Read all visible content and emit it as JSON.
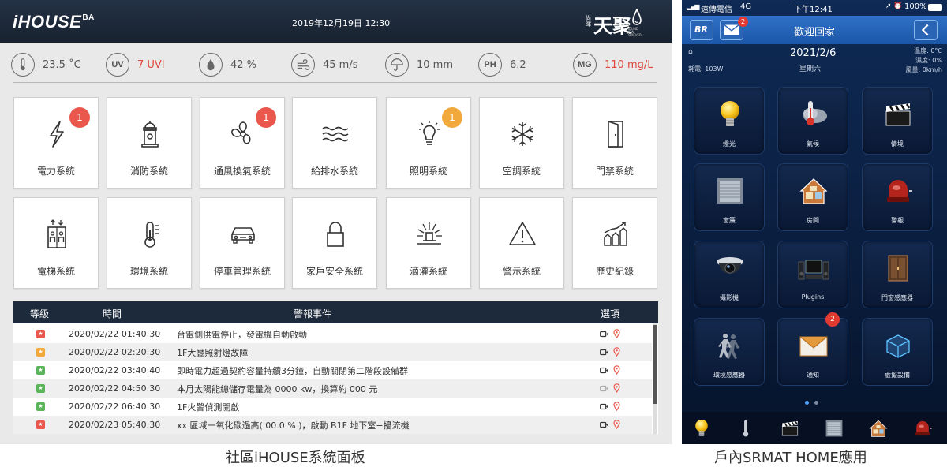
{
  "dashboard": {
    "brand": "iHOUSE",
    "brand_sup": "BA",
    "datetime": "2019年12月19日 12:30",
    "logo": {
      "small": "尚暉",
      "big": "天聚",
      "tiny": "ROUND NEW FOREVER"
    },
    "env": [
      {
        "icon": "thermometer-icon",
        "label": "",
        "value": "23.5 ˚C",
        "alert": false
      },
      {
        "icon": "uv-icon",
        "label": "UV",
        "value": "7 UVI",
        "alert": true
      },
      {
        "icon": "humidity-drop-icon",
        "label": "",
        "value": "42 %",
        "alert": false
      },
      {
        "icon": "wind-icon",
        "label": "",
        "value": "45 m/s",
        "alert": false
      },
      {
        "icon": "umbrella-icon",
        "label": "",
        "value": "10 mm",
        "alert": false
      },
      {
        "icon": "ph-icon",
        "label": "PH",
        "value": "6.2",
        "alert": false
      },
      {
        "icon": "mg-icon",
        "label": "MG",
        "value": "110 mg/L",
        "alert": true
      }
    ],
    "systems": [
      {
        "label": "電力系統",
        "icon": "lightning-icon",
        "badge": "1",
        "badge_color": "#e9574d"
      },
      {
        "label": "消防系統",
        "icon": "fire-hydrant-icon",
        "badge": "",
        "badge_color": ""
      },
      {
        "label": "通風換氣系統",
        "icon": "fan-icon",
        "badge": "1",
        "badge_color": "#e9574d"
      },
      {
        "label": "給排水系統",
        "icon": "water-waves-icon",
        "badge": "",
        "badge_color": ""
      },
      {
        "label": "照明系統",
        "icon": "light-bulb-icon",
        "badge": "1",
        "badge_color": "#f2a93b"
      },
      {
        "label": "空調系統",
        "icon": "snowflake-icon",
        "badge": "",
        "badge_color": ""
      },
      {
        "label": "門禁系統",
        "icon": "door-icon",
        "badge": "",
        "badge_color": ""
      },
      {
        "label": "電梯系統",
        "icon": "elevator-icon",
        "badge": "",
        "badge_color": ""
      },
      {
        "label": "環境系統",
        "icon": "thermometer-icon",
        "badge": "",
        "badge_color": ""
      },
      {
        "label": "停車管理系統",
        "icon": "car-icon",
        "badge": "",
        "badge_color": ""
      },
      {
        "label": "家戶安全系統",
        "icon": "lock-icon",
        "badge": "",
        "badge_color": ""
      },
      {
        "label": "滴灌系統",
        "icon": "sprinkler-icon",
        "badge": "",
        "badge_color": ""
      },
      {
        "label": "警示系統",
        "icon": "warning-icon",
        "badge": "",
        "badge_color": ""
      },
      {
        "label": "歷史紀錄",
        "icon": "chart-history-icon",
        "badge": "",
        "badge_color": ""
      }
    ],
    "alarm_table": {
      "headers": {
        "level": "等級",
        "time": "時間",
        "event": "警報事件",
        "options": "選項"
      },
      "rows": [
        {
          "level_color": "#e9574d",
          "time": "2020/02/22 01:40:30",
          "event": "台電側供電停止，發電機自動啟動",
          "cam_active": true
        },
        {
          "level_color": "#f2a93b",
          "time": "2020/02/22 02:20:30",
          "event": "1F大廳照射燈故障",
          "cam_active": true
        },
        {
          "level_color": "#5bb45a",
          "time": "2020/02/22 03:40:40",
          "event": "即時電力超過契約容量持續3分鐘，自動關閉第二階段設備群",
          "cam_active": true
        },
        {
          "level_color": "#5bb45a",
          "time": "2020/02/22 04:50:30",
          "event": "本月太陽能總儲存電量為 0000 kw，換算約 000 元",
          "cam_active": false
        },
        {
          "level_color": "#5bb45a",
          "time": "2020/02/22 06:40:30",
          "event": "1F火警偵測開啟",
          "cam_active": true
        },
        {
          "level_color": "#e9574d",
          "time": "2020/02/23 05:40:30",
          "event": "xx 區域一氧化碳過高( 00.0 % )，啟動 B1F 地下室−擾流機",
          "cam_active": true
        }
      ]
    },
    "caption": "社區iHOUSE系統面板"
  },
  "phone": {
    "status": {
      "carrier": "遠傳電信",
      "network": "4G",
      "time": "下午12:41",
      "battery": "100%"
    },
    "title": "歡迎回家",
    "logo_text": "BR",
    "mail_badge": "2",
    "date": "2021/2/6",
    "weekday": "星期六",
    "power": "耗電: 103W",
    "temp": "溫度: 0°C",
    "humidity": "濕度: 0%",
    "wind": "風量: 0km/h",
    "cards": [
      {
        "label": "燈光",
        "icon": "light-bulb-icon",
        "badge": ""
      },
      {
        "label": "氣候",
        "icon": "weather-icon",
        "badge": ""
      },
      {
        "label": "情境",
        "icon": "clapperboard-icon",
        "badge": ""
      },
      {
        "label": "窗簾",
        "icon": "window-shutter-icon",
        "badge": ""
      },
      {
        "label": "房間",
        "icon": "house-icon",
        "badge": ""
      },
      {
        "label": "警報",
        "icon": "alarm-bell-icon",
        "badge": ""
      },
      {
        "label": "攝影機",
        "icon": "security-camera-icon",
        "badge": ""
      },
      {
        "label": "Plugins",
        "icon": "stereo-icon",
        "badge": ""
      },
      {
        "label": "門窗感應器",
        "icon": "door-sensor-icon",
        "badge": ""
      },
      {
        "label": "環境感應器",
        "icon": "motion-sensor-icon",
        "badge": ""
      },
      {
        "label": "通知",
        "icon": "envelope-icon",
        "badge": "2"
      },
      {
        "label": "虛擬設備",
        "icon": "virtual-cube-icon",
        "badge": ""
      }
    ],
    "page_dots": {
      "active": 0,
      "count": 2
    },
    "tabs": [
      {
        "icon": "light-bulb-icon"
      },
      {
        "icon": "thermometer-icon"
      },
      {
        "icon": "clapperboard-icon"
      },
      {
        "icon": "window-shutter-icon"
      },
      {
        "icon": "house-icon"
      },
      {
        "icon": "alarm-bell-icon"
      }
    ],
    "caption": "戶內SRMAT HOME應用"
  }
}
